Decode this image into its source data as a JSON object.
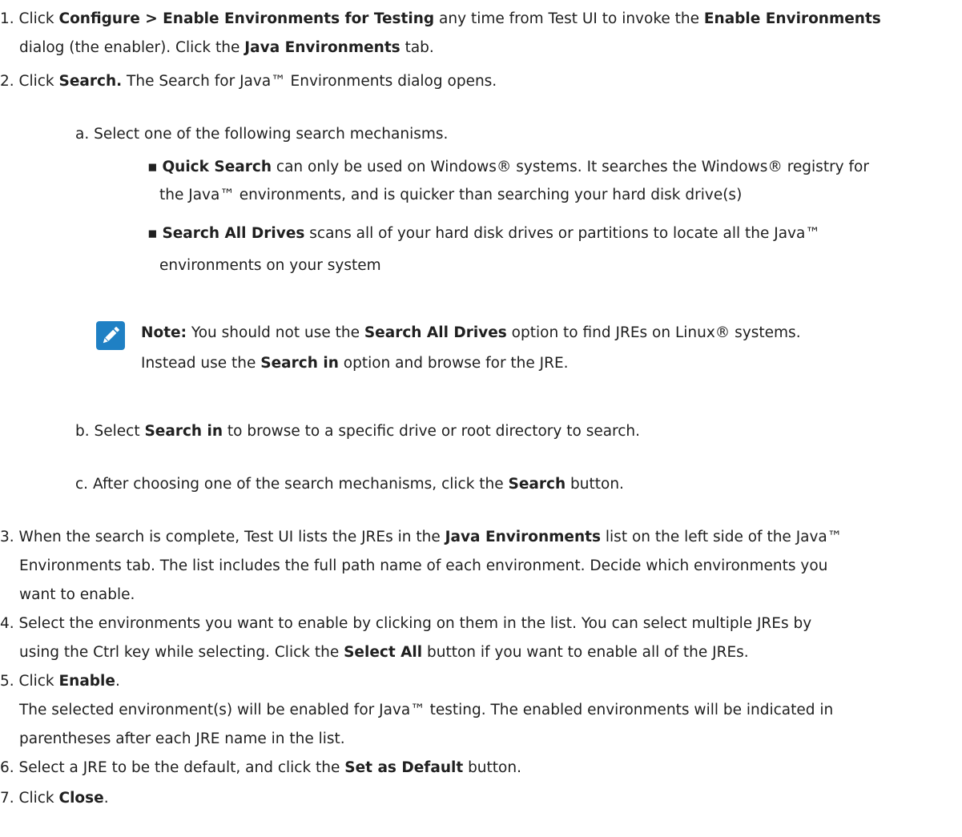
{
  "step1": {
    "num": "1.",
    "p1": "Click ",
    "b1": "Configure  > Enable Environments for Testing",
    "p2": " any time from Test UI to invoke the ",
    "b2": "Enable Environments",
    "p3": "dialog (the enabler). Click the ",
    "b3": "Java Environments",
    "p4": " tab."
  },
  "step2": {
    "num": "2.",
    "p1": "Click ",
    "b1": "Search.",
    "p2": " The Search for Java™ Environments dialog opens.",
    "sub_a": {
      "num": "a.",
      "text": "Select one of the following search mechanisms.",
      "bullets": [
        {
          "b": "Quick Search",
          "line1": " can only be used on Windows® systems. It searches the Windows® registry for",
          "line2": "the Java™ environments, and is quicker than searching your hard disk drive(s)"
        },
        {
          "b": "Search All Drives",
          "line1": " scans all of your hard disk drives or partitions to locate all the Java™",
          "line2": "environments on your system"
        }
      ],
      "note": {
        "label": "Note:",
        "p1": " You should not use the ",
        "b1": "Search All Drives",
        "p2": " option to find JREs on Linux® systems.",
        "p3": "Instead use the ",
        "b2": "Search in",
        "p4": " option and browse for the JRE."
      }
    },
    "sub_b": {
      "num": "b.",
      "p1": "Select ",
      "b1": "Search in",
      "p2": " to browse to a specific drive or root directory to search."
    },
    "sub_c": {
      "num": "c.",
      "p1": "After choosing one of the search mechanisms, click the ",
      "b1": "Search",
      "p2": " button."
    }
  },
  "step3": {
    "num": "3.",
    "p1": "When the search is complete, Test UI lists the JREs in the ",
    "b1": "Java Environments",
    "p2": " list on the left side of the Java™",
    "line2": "Environments tab. The list includes the full path name of each environment. Decide which environments you",
    "line3": "want to enable."
  },
  "step4": {
    "num": "4.",
    "line1": "Select the environments you want to enable by clicking on them in the list. You can select multiple JREs by",
    "p1": "using the Ctrl key while selecting. Click the ",
    "b1": "Select All",
    "p2": " button if you want to enable all of the JREs."
  },
  "step5": {
    "num": "5.",
    "p1": "Click ",
    "b1": "Enable",
    "p2": ".",
    "line2": "The selected environment(s) will be enabled for Java™ testing. The enabled environments will be indicated in",
    "line3": "parentheses after each JRE name in the list."
  },
  "step6": {
    "num": "6.",
    "p1": "Select a JRE to be the default, and click the ",
    "b1": "Set as Default",
    "p2": " button."
  },
  "step7": {
    "num": "7.",
    "p1": "Click ",
    "b1": "Close",
    "p2": "."
  },
  "icons": {
    "note": "pencil-icon"
  },
  "colors": {
    "note_icon_bg": "#1f80c4"
  }
}
